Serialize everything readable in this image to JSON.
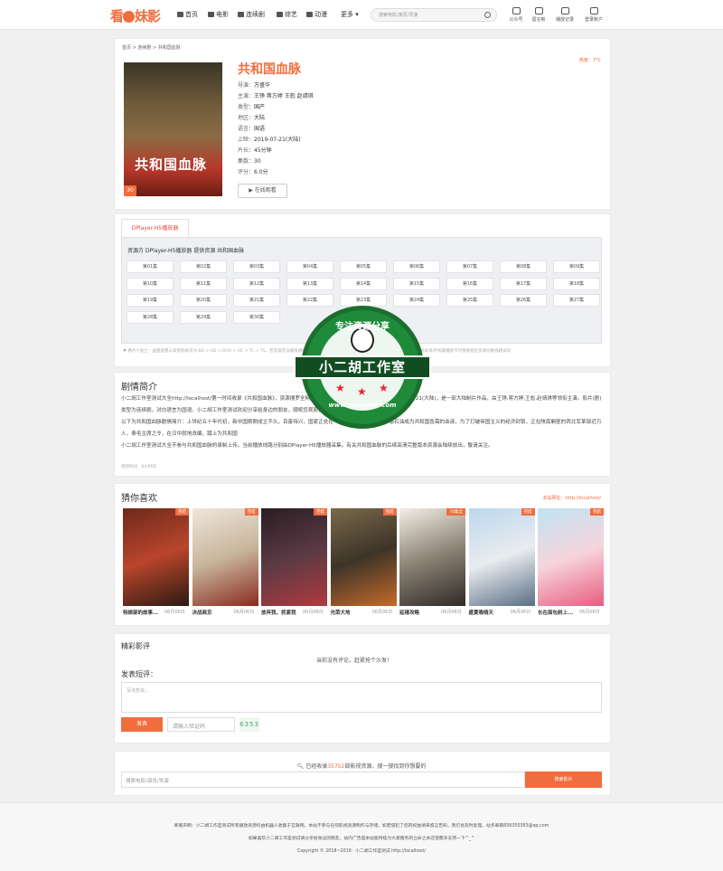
{
  "header": {
    "logo": "看妹影",
    "nav": [
      {
        "label": "首页",
        "icon": "home-icon"
      },
      {
        "label": "电影",
        "icon": "film-icon"
      },
      {
        "label": "连续剧",
        "icon": "tv-icon"
      },
      {
        "label": "综艺",
        "icon": "mic-icon"
      },
      {
        "label": "动漫",
        "icon": "gamepad-icon"
      },
      {
        "label": "更多",
        "icon": "chevron-down-icon"
      }
    ],
    "search_placeholder": "搜索电影/演员/导演",
    "right_icons": [
      {
        "label": "公众号",
        "icon": "wechat-icon"
      },
      {
        "label": "留言板",
        "icon": "edit-icon"
      },
      {
        "label": "播放记录",
        "icon": "history-icon"
      },
      {
        "label": "登录账户",
        "icon": "user-icon"
      }
    ]
  },
  "detail": {
    "breadcrumb": "首页 > 连续剧 > 共和国血脉",
    "poster_text": "共和国血脉",
    "poster_badge": "30",
    "title": "共和国血脉",
    "heat": "热度：7°C",
    "rows": [
      {
        "k": "导演：",
        "v": "万盛华"
      },
      {
        "k": "主演：",
        "v": "王铮 蒋方婷 王彪 赵靖琪"
      },
      {
        "k": "类型：",
        "v": "国产"
      },
      {
        "k": "地区：",
        "v": "大陆"
      },
      {
        "k": "语言：",
        "v": "国语"
      },
      {
        "k": "上映：",
        "v": "2019-07-21(大陆)"
      },
      {
        "k": "片长：",
        "v": "45分钟"
      },
      {
        "k": "集数：",
        "v": "30"
      },
      {
        "k": "评分：",
        "v": "6.0分"
      }
    ],
    "watch_button": "▶ 在线观看"
  },
  "player": {
    "tab": "DPlayer-H5播放器",
    "source": "资源方 DPlayer-H5播放器 提供资源 共和国血脉",
    "episodes": [
      "第01集",
      "第02集",
      "第03集",
      "第04集",
      "第05集",
      "第06集",
      "第07集",
      "第08集",
      "第09集",
      "第10集",
      "第11集",
      "第12集",
      "第13集",
      "第14集",
      "第15集",
      "第16集",
      "第17集",
      "第18集",
      "第19集",
      "第20集",
      "第21集",
      "第22集",
      "第23集",
      "第24集",
      "第25集",
      "第26集",
      "第27集",
      "第28集",
      "第29集",
      "第30集"
    ],
    "tip": "♥ 看片小贴士：画面质量从高到低依次为 BD > HD > DVD > HC > TC > TS，若资源无法播放请切换其他资源或稍后再试，部分手机或浏览器不能播放可切换手机试试/如手机端播放卡可搜索相应资源切换线路试试"
  },
  "synopsis": {
    "title": "剧情简介",
    "p1": "小二胡工作室测试大全http://localhost/第一时间收录《共和国血脉》，资源搜罗全网，在线播放高清无广告。该剧首映于 2019-07-21(大陆)，是一部大陆制片作品，由王铮,蒋方婷,王彪,赵靖琪等领衔主演。影片(剧)类型为连续剧，对白语言为国语。小二胡工作室测试欢迎分享给身边的朋友，顺祝您观影愉快！",
    "p2": "以下为共和国血脉剧情简介：上世纪五十年代初，新中国刚刚成立不久，百废待兴，国家正处在一个政治、经济、内忧外患石油成为共和国急需的血液，为了打破帝国主义的经济封锁，正在陕南剿匪的西北军革部近万人，奉毛主席之令，在汉中就地改编，踏上为共和国",
    "p3": "小二胡工作室测试大全不参与共和国血脉的录制上传，当前播放线路分别由DPlayer-H5播放器采集。有关共和国血脉的后续高清完整版本资源会陆续放出，敬请关注。",
    "updated": "更新时间：6小时前"
  },
  "recommend": {
    "title": "猜你喜欢",
    "site": "本站网址：http://localhost/",
    "items": [
      {
        "name": "特娘部的故事...",
        "date": "06月06日",
        "tag": "完结"
      },
      {
        "name": "决战商京",
        "date": "06月06日",
        "tag": "完结"
      },
      {
        "name": "放弃我、抓紧我",
        "date": "06月06日",
        "tag": "完结"
      },
      {
        "name": "光荣大地",
        "date": "06月06日",
        "tag": "完结"
      },
      {
        "name": "延禧攻略",
        "date": "06月06日",
        "tag": "70集全"
      },
      {
        "name": "盛夏晚晴天",
        "date": "06月06日",
        "tag": "完结"
      },
      {
        "name": "长在面包树上...",
        "date": "06月06日",
        "tag": "完结"
      }
    ]
  },
  "comments": {
    "title": "精彩影评",
    "empty": "当前没有评论，赶紧抢个沙发！",
    "post_label": "发表短评：",
    "placeholder": "写点想说...",
    "send": "发表",
    "code_placeholder": "请输入验证码",
    "code": "6353"
  },
  "bottom_search": {
    "count_prefix": "已经收录",
    "count": "35752",
    "count_suffix": "部影视资源，搜一搜找到你想要的",
    "placeholder": "搜索电影/演员/导演",
    "button": "搜索影片"
  },
  "footer": {
    "line1": "郑重声明：小二胡工作室测试所有播放资源均由机器人收集于互联网，本站不参与任何影视资源制作与存储，如若侵犯了您的权益请来留言告知，我们会及时处理。站务邮箱656350363@qq.com",
    "line2": "如果喜欢小二胡工作室测试请分享给身边的朋友，站内广告是本站能持续为大家服务的立命之本还望都多支持一下^_^",
    "line3": "Copyright © 2018~2019 · 小二胡工作室测试 http://localhost/"
  },
  "watermark": {
    "top": "专注资源分享",
    "band": "小二胡工作室",
    "bottom": "www.xiaoerhu.com"
  }
}
